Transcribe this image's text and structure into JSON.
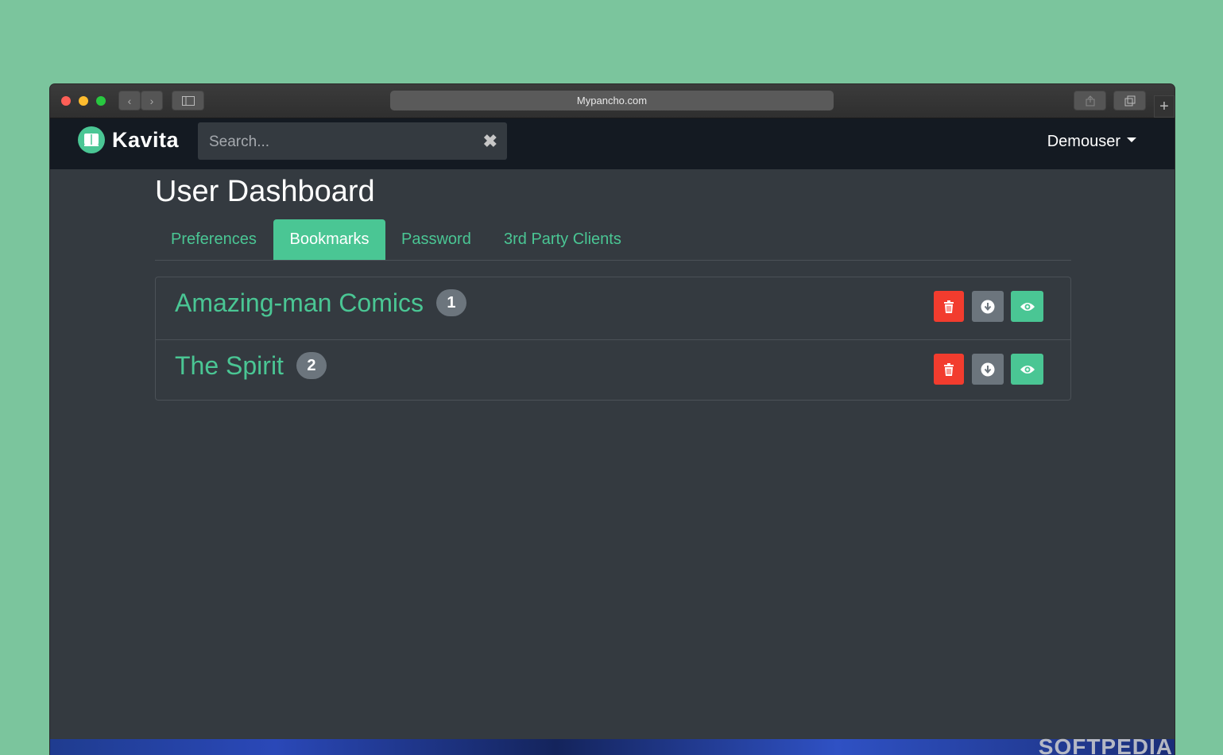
{
  "browser": {
    "url": "Mypancho.com"
  },
  "app": {
    "brand": "Kavita",
    "search_placeholder": "Search...",
    "user_menu": "Demouser"
  },
  "page": {
    "title": "User Dashboard",
    "tabs": [
      {
        "label": "Preferences",
        "active": false
      },
      {
        "label": "Bookmarks",
        "active": true
      },
      {
        "label": "Password",
        "active": false
      },
      {
        "label": "3rd Party Clients",
        "active": false
      }
    ]
  },
  "bookmarks": [
    {
      "title": "Amazing-man Comics",
      "count": "1"
    },
    {
      "title": "The Spirit",
      "count": "2"
    }
  ],
  "watermark": "SOFTPEDIA",
  "colors": {
    "accent": "#4ac694",
    "danger": "#f23c2e",
    "secondary": "#6c757d",
    "background": "#343a40",
    "navbar": "#141a22"
  },
  "icons": {
    "delete": "trash-icon",
    "download": "download-icon",
    "view": "eye-icon"
  }
}
